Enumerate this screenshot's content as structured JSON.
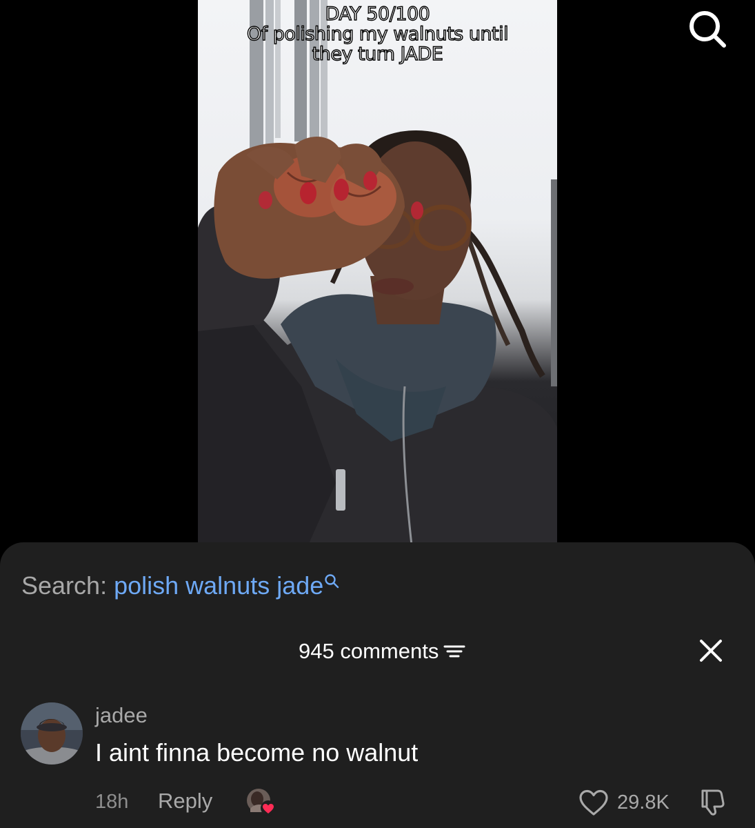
{
  "video": {
    "caption_lines": [
      "DAY 50/100",
      "Of polishing my walnuts until",
      "they turn JADE"
    ]
  },
  "top_bar": {
    "search_icon": "search-icon"
  },
  "search_suggestion": {
    "prefix": "Search:",
    "query": "polish walnuts jade",
    "icon": "search-icon"
  },
  "comments_header": {
    "count_label": "945 comments",
    "sort_icon": "sort-filter-icon",
    "close_icon": "close-icon"
  },
  "comment": {
    "username": "jadee",
    "text": "I aint finna become no walnut",
    "time": "18h",
    "reply_label": "Reply",
    "likes": "29.8K",
    "creator_liked_icon": "heart-badge-icon",
    "like_icon": "heart-outline-icon",
    "dislike_icon": "thumbs-down-icon"
  },
  "colors": {
    "sheet_background": "#1f1f1f",
    "link_blue": "#6ea9f5",
    "secondary_text": "#a9a9a9",
    "heart_red": "#fe2c55"
  }
}
